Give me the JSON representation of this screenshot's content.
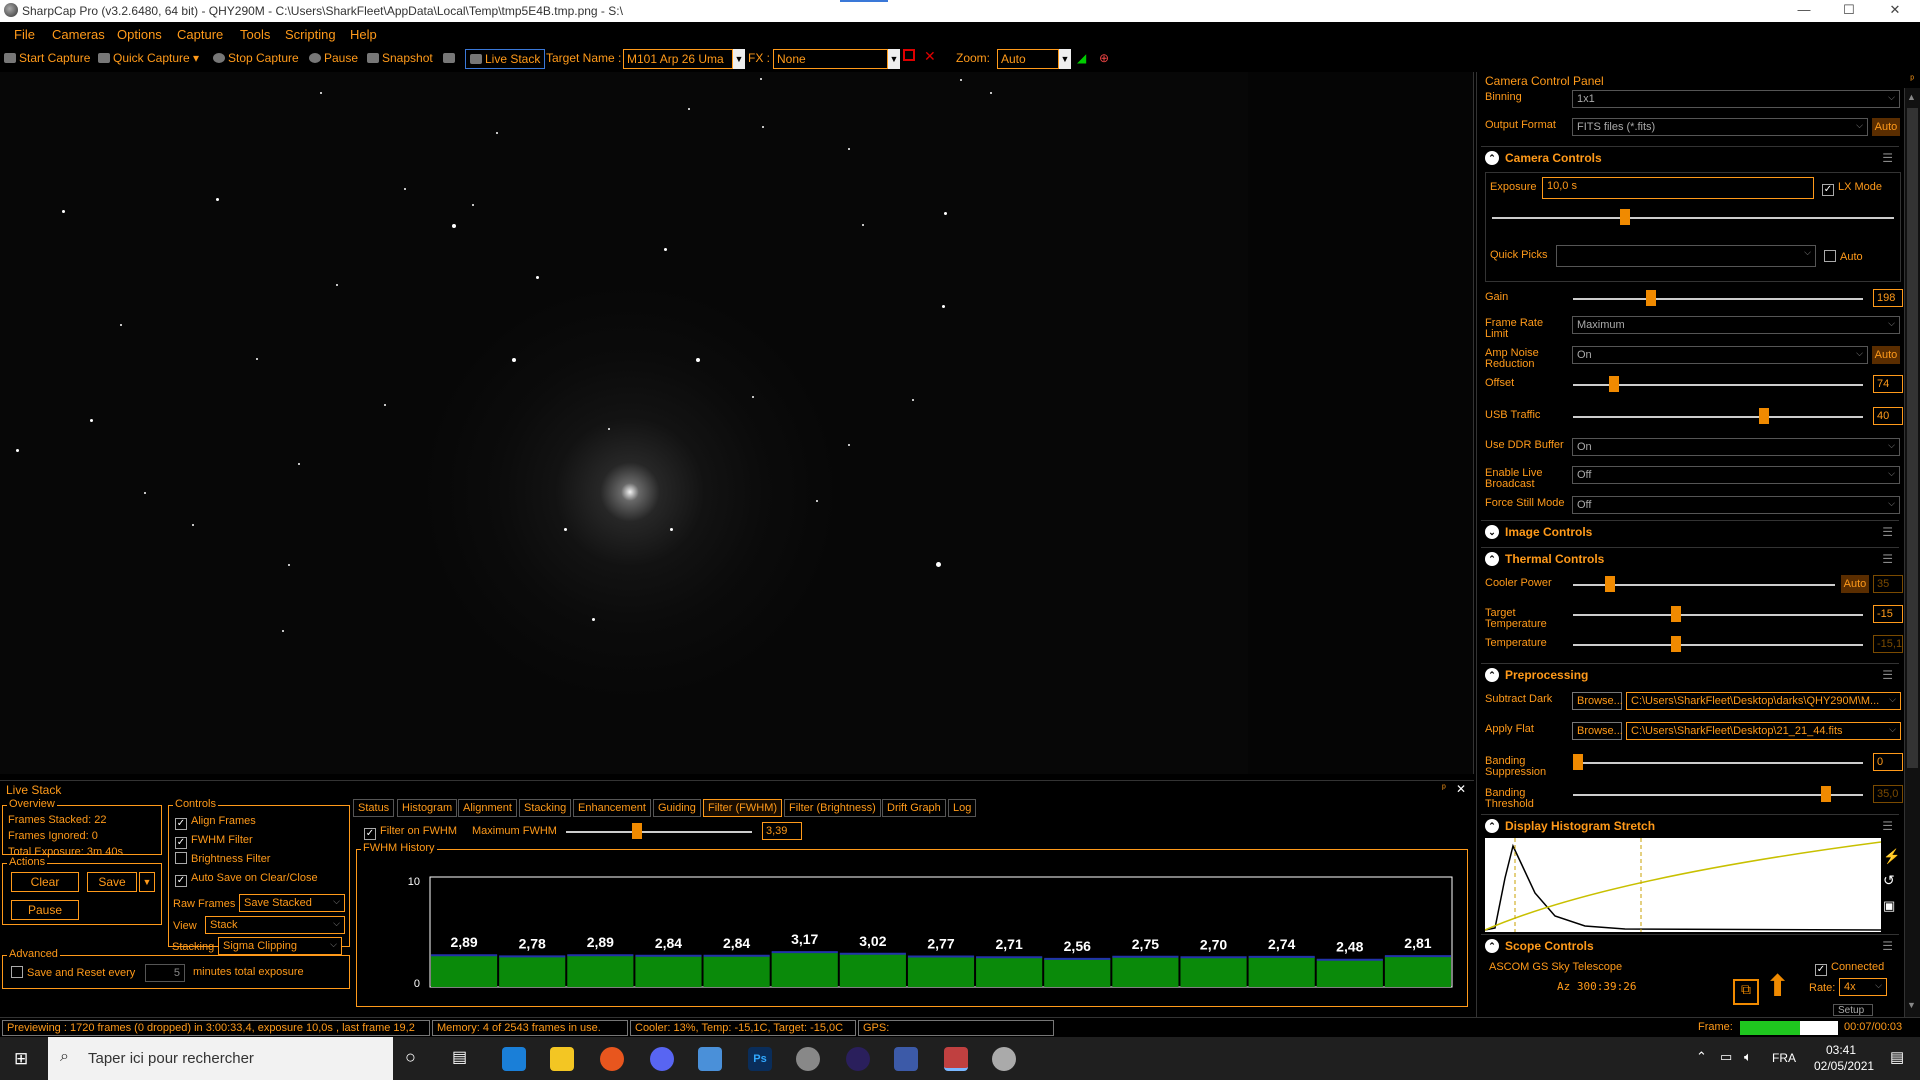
{
  "window": {
    "title": "SharpCap Pro (v3.2.6480, 64 bit) - QHY290M - C:\\Users\\SharkFleet\\AppData\\Local\\Temp\\tmp5E4B.tmp.png - S:\\",
    "minimize": "—",
    "maximize": "☐",
    "close": "✕"
  },
  "menu": [
    "File",
    "Cameras",
    "Options",
    "Capture",
    "Tools",
    "Scripting",
    "Help"
  ],
  "toolbar": {
    "start_capture": "Start Capture",
    "quick_capture": "Quick Capture",
    "stop_capture": "Stop Capture",
    "pause": "Pause",
    "snapshot": "Snapshot",
    "live_stack": "Live Stack",
    "target_label": "Target Name :",
    "target_value": "M101 Arp 26 Uma",
    "fx_label": "FX :",
    "fx_value": "None",
    "zoom_label": "Zoom:",
    "zoom_value": "Auto"
  },
  "panel": {
    "title": "Camera Control Panel",
    "binning_label": "Binning",
    "binning_value": "1x1",
    "output_format_label": "Output Format",
    "output_format_value": "FITS files (*.fits)",
    "auto": "Auto",
    "camera_controls": {
      "header": "Camera Controls",
      "exposure_label": "Exposure",
      "exposure_value": "10,0 s",
      "lx_mode": "LX Mode",
      "quick_picks_label": "Quick Picks",
      "quick_picks_auto": "Auto",
      "gain_label": "Gain",
      "gain_value": "198",
      "gain_fraction": 0.27,
      "frame_rate_label": "Frame Rate Limit",
      "frame_rate_value": "Maximum",
      "amp_noise_label": "Amp Noise Reduction",
      "amp_noise_value": "On",
      "offset_label": "Offset",
      "offset_value": "74",
      "offset_fraction": 0.14,
      "usb_label": "USB Traffic",
      "usb_value": "40",
      "usb_fraction": 0.66,
      "ddr_label": "Use DDR Buffer",
      "ddr_value": "On",
      "broadcast_label": "Enable Live Broadcast",
      "broadcast_value": "Off",
      "still_label": "Force Still Mode",
      "still_value": "Off"
    },
    "image_controls": {
      "header": "Image Controls"
    },
    "thermal": {
      "header": "Thermal Controls",
      "cooler_label": "Cooler Power",
      "cooler_auto": "Auto",
      "cooler_value": "35",
      "target_temp_label": "Target Temperature",
      "target_temp_value": "-15",
      "temp_label": "Temperature",
      "temp_value": "-15,1"
    },
    "preprocessing": {
      "header": "Preprocessing",
      "dark_label": "Subtract Dark",
      "browse": "Browse...",
      "dark_path": "C:\\Users\\SharkFleet\\Desktop\\darks\\QHY290M\\M...",
      "flat_label": "Apply Flat",
      "flat_path": "C:\\Users\\SharkFleet\\Desktop\\21_21_44.fits",
      "banding_sup_label": "Banding Suppression",
      "banding_sup_value": "0",
      "banding_thr_label": "Banding Threshold",
      "banding_thr_value": "35,0"
    },
    "histogram": {
      "header": "Display Histogram Stretch"
    },
    "scope": {
      "header": "Scope Controls",
      "name": "ASCOM GS Sky Telescope",
      "connected": "Connected",
      "az": "Az  300:39:26",
      "rate_label": "Rate:",
      "rate_value": "4x",
      "setup": "Setup"
    },
    "frame_label": "Frame:",
    "frame_time": "00:07/00:03"
  },
  "livestack": {
    "title": "Live Stack",
    "overview_label": "Overview",
    "frames_stacked": "Frames Stacked:  22",
    "frames_ignored": "Frames Ignored:   0",
    "total_exposure": "Total Exposure:   3m 40s",
    "actions_label": "Actions",
    "clear": "Clear",
    "save": "Save",
    "pause": "Pause",
    "advanced_label": "Advanced",
    "save_reset_prefix": "Save and Reset every",
    "save_reset_value": "5",
    "save_reset_suffix": "minutes total exposure",
    "controls_label": "Controls",
    "align_frames": "Align Frames",
    "fwhm_filter": "FWHM Filter",
    "brightness_filter": "Brightness Filter",
    "auto_save": "Auto Save on Clear/Close",
    "raw_frames_label": "Raw Frames",
    "raw_frames_value": "Save Stacked",
    "view_label": "View",
    "view_value": "Stack",
    "stacking_label": "Stacking",
    "stacking_value": "Sigma Clipping",
    "tabs": [
      "Status",
      "Histogram",
      "Alignment",
      "Stacking",
      "Enhancement",
      "Guiding",
      "Filter (FWHM)",
      "Filter (Brightness)",
      "Drift Graph",
      "Log"
    ],
    "filter_on_fwhm": "Filter on FWHM",
    "max_fwhm_label": "Maximum FWHM",
    "max_fwhm_value": "3,39",
    "max_fwhm_fraction": 0.38,
    "fwhm_history_label": "FWHM History"
  },
  "chart_data": {
    "type": "bar",
    "title": "FWHM History",
    "ylim": [
      0,
      10
    ],
    "yticks": [
      "10",
      "0"
    ],
    "values": [
      2.89,
      2.78,
      2.89,
      2.84,
      2.84,
      3.17,
      3.02,
      2.77,
      2.71,
      2.56,
      2.75,
      2.7,
      2.74,
      2.48,
      2.81
    ],
    "labels": [
      "2,89",
      "2,78",
      "2,89",
      "2,84",
      "2,84",
      "3,17",
      "3,02",
      "2,77",
      "2,71",
      "2,56",
      "2,75",
      "2,70",
      "2,74",
      "2,48",
      "2,81"
    ],
    "bar_color": "#0a8a0a",
    "threshold": 3.39
  },
  "status": {
    "preview": "Previewing : 1720 frames (0 dropped) in 3:00:33,4, exposure 10,0s , last frame 19,2",
    "memory": "Memory: 4 of 2543 frames in use.",
    "cooler": "Cooler: 13%, Temp: -15,1C, Target: -15,0C",
    "gps": "GPS:"
  },
  "taskbar": {
    "search_placeholder": "Taper ici pour rechercher",
    "lang": "FRA",
    "time": "03:41",
    "date": "02/05/2021"
  }
}
